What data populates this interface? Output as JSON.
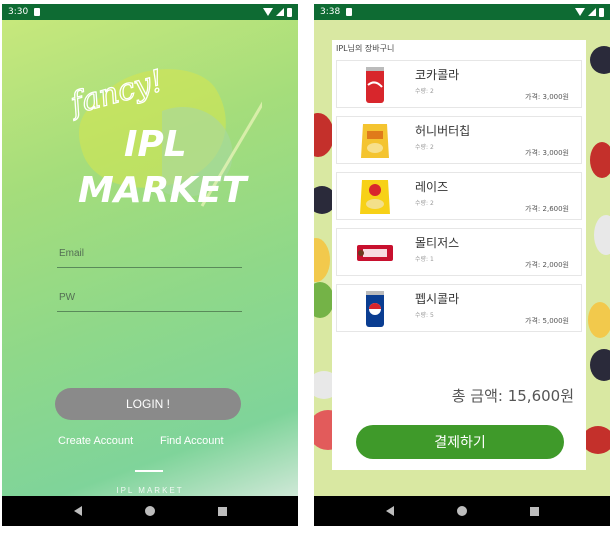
{
  "login_screen": {
    "status_time": "3:30",
    "logo": {
      "script": "fancy!",
      "line1": "IPL",
      "line2": "MARKET"
    },
    "email_placeholder": "Email",
    "pw_placeholder": "PW",
    "login_label": "LOGIN !",
    "create_account": "Create Account",
    "find_account": "Find Account",
    "footer": "IPL MARKET",
    "colors": {
      "gradient_top": "#c7e87c",
      "gradient_bottom": "#7fd49a",
      "button": "#8a8a8a"
    }
  },
  "cart_screen": {
    "status_time": "3:38",
    "title": "IPL님의 장바구니",
    "items": [
      {
        "name": "코카콜라",
        "qty": "수량: 2",
        "price": "가격: 3,000원",
        "icon": "coca-cola-can"
      },
      {
        "name": "허니버터칩",
        "qty": "수량: 2",
        "price": "가격: 3,000원",
        "icon": "honey-butter-chip-bag"
      },
      {
        "name": "레이즈",
        "qty": "수량: 2",
        "price": "가격: 2,600원",
        "icon": "lays-bag"
      },
      {
        "name": "몰티저스",
        "qty": "수량: 1",
        "price": "가격: 2,000원",
        "icon": "maltesers-pack"
      },
      {
        "name": "펩시콜라",
        "qty": "수량: 5",
        "price": "가격: 5,000원",
        "icon": "pepsi-can"
      }
    ],
    "total": "총 금액: 15,600원",
    "pay_label": "결제하기",
    "colors": {
      "pay_button": "#3f9a2a"
    }
  }
}
